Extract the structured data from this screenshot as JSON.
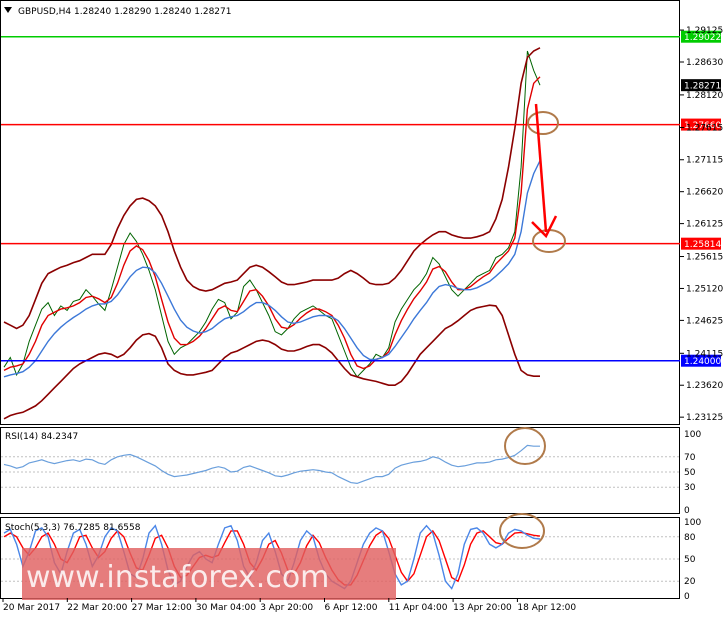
{
  "header": {
    "symbol": "GBPUSD,H4",
    "open": "1.28240",
    "high": "1.28290",
    "low": "1.28240",
    "close": "1.28271"
  },
  "watermark": "www.instaforex.com",
  "colors": {
    "price": "#006400",
    "ma_fast": "#e00000",
    "ma_slow": "#3c78d8",
    "bands": "#8b0000",
    "resistance": "#ff0000",
    "top_level": "#00cc00",
    "support": "#0000ff",
    "annotation": "#b07a4a",
    "rsi": "#6a9fdc",
    "stoch_main": "#4a86e8",
    "stoch_signal": "#ff0000",
    "watermark_bg": "#e06060"
  },
  "chart_data": [
    {
      "type": "line",
      "panel": "main",
      "title": "GBPUSD,H4",
      "x_tick_labels": [
        "20 Mar 2017",
        "22 Mar 20:00",
        "27 Mar 12:00",
        "30 Mar 04:00",
        "3 Apr 20:00",
        "6 Apr 12:00",
        "11 Apr 04:00",
        "13 Apr 20:00",
        "18 Apr 12:00"
      ],
      "y_tick_labels": [
        "1.29125",
        "1.28630",
        "1.28120",
        "1.27615",
        "1.27115",
        "1.26620",
        "1.26125",
        "1.25615",
        "1.25120",
        "1.24625",
        "1.24115",
        "1.23620",
        "1.23125"
      ],
      "ylim": [
        1.2305,
        1.2925
      ],
      "price_labels": {
        "current": "1.28271"
      },
      "horizontal_levels": [
        {
          "value": 1.29022,
          "label": "1.29022",
          "color": "#00cc00"
        },
        {
          "value": 1.2766,
          "label": "1.27660",
          "color": "#ff0000"
        },
        {
          "value": 1.25814,
          "label": "1.25814",
          "color": "#ff0000"
        },
        {
          "value": 1.24,
          "label": "1.24000",
          "color": "#0000ff"
        }
      ],
      "series": [
        {
          "role": "close",
          "values": [
            1.239,
            1.2405,
            1.2378,
            1.2395,
            1.243,
            1.2455,
            1.248,
            1.249,
            1.247,
            1.2485,
            1.2478,
            1.2492,
            1.2495,
            1.251,
            1.25,
            1.2488,
            1.2478,
            1.251,
            1.2545,
            1.258,
            1.2598,
            1.2585,
            1.2565,
            1.254,
            1.251,
            1.247,
            1.243,
            1.241,
            1.242,
            1.2425,
            1.2435,
            1.2445,
            1.246,
            1.248,
            1.2495,
            1.249,
            1.2465,
            1.2475,
            1.2515,
            1.2525,
            1.251,
            1.249,
            1.247,
            1.2445,
            1.244,
            1.245,
            1.2465,
            1.2475,
            1.248,
            1.2485,
            1.2478,
            1.247,
            1.2465,
            1.244,
            1.2415,
            1.239,
            1.2375,
            1.2385,
            1.2395,
            1.241,
            1.2405,
            1.242,
            1.246,
            1.248,
            1.2495,
            1.251,
            1.252,
            1.2535,
            1.256,
            1.255,
            1.253,
            1.251,
            1.25,
            1.251,
            1.252,
            1.253,
            1.2535,
            1.254,
            1.256,
            1.2565,
            1.2575,
            1.26,
            1.27,
            1.288,
            1.285,
            1.2827
          ]
        },
        {
          "role": "ma_fast",
          "values": [
            1.2385,
            1.239,
            1.2392,
            1.2395,
            1.241,
            1.243,
            1.2455,
            1.247,
            1.2475,
            1.248,
            1.2482,
            1.2485,
            1.249,
            1.2498,
            1.25,
            1.2496,
            1.249,
            1.2498,
            1.252,
            1.2548,
            1.257,
            1.2578,
            1.2572,
            1.2555,
            1.253,
            1.2495,
            1.246,
            1.2435,
            1.2425,
            1.2425,
            1.243,
            1.2438,
            1.245,
            1.2465,
            1.248,
            1.2485,
            1.2478,
            1.2476,
            1.2492,
            1.2508,
            1.251,
            1.25,
            1.2485,
            1.2465,
            1.2452,
            1.245,
            1.2456,
            1.2466,
            1.2474,
            1.248,
            1.248,
            1.2476,
            1.247,
            1.2455,
            1.2435,
            1.241,
            1.2392,
            1.2388,
            1.2392,
            1.2402,
            1.2405,
            1.2414,
            1.244,
            1.2462,
            1.248,
            1.2496,
            1.2508,
            1.2522,
            1.2542,
            1.2546,
            1.2538,
            1.2522,
            1.251,
            1.251,
            1.2515,
            1.2523,
            1.253,
            1.2536,
            1.255,
            1.256,
            1.257,
            1.259,
            1.266,
            1.279,
            1.283,
            1.284
          ]
        },
        {
          "role": "ma_slow",
          "values": [
            1.2375,
            1.2378,
            1.238,
            1.2383,
            1.239,
            1.24,
            1.2415,
            1.243,
            1.2442,
            1.2452,
            1.246,
            1.2467,
            1.2473,
            1.248,
            1.2485,
            1.2488,
            1.2488,
            1.2492,
            1.2502,
            1.2516,
            1.253,
            1.254,
            1.2545,
            1.2544,
            1.2536,
            1.252,
            1.25,
            1.248,
            1.2463,
            1.2452,
            1.2446,
            1.2443,
            1.2445,
            1.245,
            1.2458,
            1.2465,
            1.2468,
            1.247,
            1.2476,
            1.2484,
            1.249,
            1.249,
            1.2486,
            1.2478,
            1.2468,
            1.246,
            1.2458,
            1.246,
            1.2464,
            1.2468,
            1.247,
            1.247,
            1.2468,
            1.2462,
            1.245,
            1.2435,
            1.242,
            1.2408,
            1.2402,
            1.2402,
            1.2405,
            1.241,
            1.2422,
            1.2436,
            1.245,
            1.2465,
            1.2478,
            1.249,
            1.2505,
            1.2515,
            1.2518,
            1.2516,
            1.2512,
            1.251,
            1.251,
            1.2513,
            1.2518,
            1.2523,
            1.2531,
            1.254,
            1.255,
            1.2565,
            1.26,
            1.266,
            1.269,
            1.271
          ]
        },
        {
          "role": "band_upper",
          "values": [
            1.246,
            1.2455,
            1.245,
            1.2455,
            1.247,
            1.2495,
            1.252,
            1.2535,
            1.254,
            1.2545,
            1.2548,
            1.2552,
            1.2555,
            1.256,
            1.2565,
            1.2565,
            1.2565,
            1.258,
            1.2605,
            1.2625,
            1.264,
            1.265,
            1.2652,
            1.2648,
            1.264,
            1.2625,
            1.26,
            1.257,
            1.2545,
            1.2525,
            1.2515,
            1.251,
            1.2508,
            1.251,
            1.2515,
            1.252,
            1.2522,
            1.2525,
            1.2535,
            1.2545,
            1.2548,
            1.2545,
            1.2538,
            1.253,
            1.2522,
            1.2518,
            1.2518,
            1.252,
            1.2522,
            1.2525,
            1.2525,
            1.2525,
            1.2525,
            1.2528,
            1.2535,
            1.254,
            1.2535,
            1.2528,
            1.252,
            1.2518,
            1.2518,
            1.252,
            1.2528,
            1.254,
            1.2555,
            1.257,
            1.258,
            1.2588,
            1.2595,
            1.26,
            1.26,
            1.2595,
            1.2592,
            1.259,
            1.259,
            1.2592,
            1.2595,
            1.26,
            1.262,
            1.265,
            1.27,
            1.276,
            1.283,
            1.287,
            1.288,
            1.2885
          ]
        },
        {
          "role": "band_lower",
          "values": [
            1.231,
            1.2315,
            1.2318,
            1.232,
            1.2325,
            1.233,
            1.2338,
            1.2348,
            1.2358,
            1.2368,
            1.2378,
            1.2388,
            1.2395,
            1.24,
            1.2405,
            1.241,
            1.2412,
            1.241,
            1.2405,
            1.241,
            1.242,
            1.2432,
            1.244,
            1.2442,
            1.2438,
            1.242,
            1.2395,
            1.2385,
            1.238,
            1.2378,
            1.2378,
            1.238,
            1.2382,
            1.2385,
            1.2395,
            1.2405,
            1.2412,
            1.2415,
            1.242,
            1.2425,
            1.243,
            1.2432,
            1.243,
            1.2425,
            1.2418,
            1.2415,
            1.2415,
            1.2418,
            1.2422,
            1.2425,
            1.2425,
            1.242,
            1.2412,
            1.24,
            1.2388,
            1.2378,
            1.2375,
            1.2372,
            1.237,
            1.2368,
            1.2365,
            1.2362,
            1.2362,
            1.2368,
            1.238,
            1.2395,
            1.241,
            1.242,
            1.243,
            1.244,
            1.245,
            1.2455,
            1.2462,
            1.247,
            1.2478,
            1.2482,
            1.2484,
            1.2486,
            1.2485,
            1.247,
            1.244,
            1.241,
            1.2385,
            1.2378,
            1.2376,
            1.2376
          ]
        }
      ]
    },
    {
      "type": "line",
      "panel": "rsi",
      "label": "RSI(14) 84.2347",
      "ylim": [
        0,
        100
      ],
      "y_tick_labels": [
        "100",
        "70",
        "50",
        "30",
        "0"
      ],
      "series": [
        {
          "role": "rsi",
          "values": [
            60,
            58,
            55,
            57,
            62,
            64,
            66,
            63,
            61,
            63,
            65,
            66,
            64,
            67,
            66,
            62,
            60,
            66,
            70,
            72,
            73,
            70,
            66,
            62,
            58,
            52,
            47,
            44,
            45,
            46,
            48,
            50,
            52,
            55,
            57,
            55,
            50,
            51,
            56,
            58,
            55,
            52,
            49,
            45,
            44,
            46,
            49,
            51,
            52,
            53,
            52,
            50,
            49,
            44,
            40,
            36,
            35,
            38,
            41,
            44,
            44,
            47,
            55,
            59,
            61,
            63,
            64,
            66,
            70,
            68,
            63,
            59,
            57,
            58,
            60,
            62,
            62,
            63,
            66,
            67,
            69,
            72,
            78,
            85,
            84,
            84
          ]
        }
      ]
    },
    {
      "type": "line",
      "panel": "stochastic",
      "label": "Stoch(5,3,3) 76.7285 81.6558",
      "ylim": [
        0,
        100
      ],
      "y_tick_labels": [
        "100",
        "80",
        "50",
        "20",
        "0"
      ],
      "series": [
        {
          "role": "main",
          "values": [
            85,
            90,
            70,
            40,
            60,
            88,
            92,
            80,
            45,
            30,
            60,
            85,
            90,
            70,
            40,
            55,
            80,
            92,
            88,
            60,
            30,
            25,
            50,
            85,
            95,
            70,
            35,
            15,
            20,
            40,
            55,
            60,
            50,
            45,
            70,
            92,
            95,
            75,
            40,
            25,
            45,
            75,
            85,
            60,
            30,
            20,
            45,
            75,
            88,
            80,
            50,
            30,
            20,
            15,
            10,
            20,
            45,
            70,
            85,
            92,
            88,
            60,
            30,
            15,
            20,
            50,
            85,
            95,
            85,
            55,
            20,
            10,
            30,
            70,
            90,
            92,
            85,
            70,
            65,
            70,
            85,
            90,
            88,
            82,
            78,
            77
          ]
        },
        {
          "role": "signal",
          "values": [
            80,
            85,
            80,
            65,
            55,
            65,
            80,
            85,
            70,
            50,
            45,
            60,
            80,
            82,
            65,
            52,
            60,
            78,
            88,
            80,
            58,
            38,
            35,
            55,
            78,
            82,
            65,
            40,
            25,
            28,
            40,
            52,
            55,
            52,
            55,
            72,
            88,
            88,
            70,
            45,
            35,
            50,
            70,
            75,
            58,
            35,
            30,
            45,
            68,
            82,
            72,
            52,
            35,
            22,
            15,
            15,
            28,
            48,
            68,
            82,
            88,
            78,
            55,
            32,
            20,
            30,
            55,
            80,
            88,
            75,
            50,
            25,
            20,
            42,
            70,
            85,
            88,
            80,
            72,
            70,
            78,
            85,
            86,
            84,
            82,
            81
          ]
        }
      ]
    }
  ]
}
